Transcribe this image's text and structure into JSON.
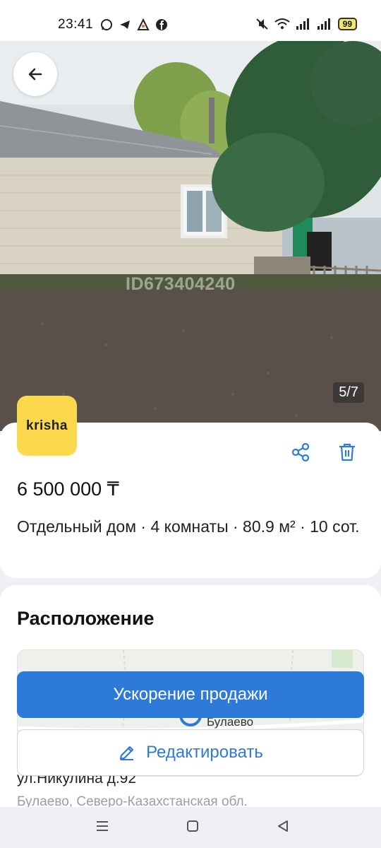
{
  "status_bar": {
    "time": "23:41",
    "left_icons": [
      "whatsapp-icon",
      "telegram-icon",
      "vpn-icon",
      "facebook-icon"
    ],
    "right_icons": [
      "mute-icon",
      "wifi-icon",
      "signal-icon",
      "signal-icon"
    ],
    "battery": "99"
  },
  "gallery": {
    "counter": "5/7",
    "watermark": "ID673404240"
  },
  "listing": {
    "brand": "krisha",
    "price": "6 500 000 ₸",
    "description": "Отдельный дом · 4 комнаты · 80.9 м² · 10 сот."
  },
  "location": {
    "title": "Расположение",
    "map_label": "Булаево",
    "address": "ул.Никулина д.92",
    "address_sub": "Булаево, Северо-Казахстанская обл."
  },
  "actions": {
    "boost_label": "Ускорение продажи",
    "edit_label": "Редактировать"
  },
  "colors": {
    "accent": "#2e7ad9",
    "brand_yellow": "#fcd84c"
  }
}
